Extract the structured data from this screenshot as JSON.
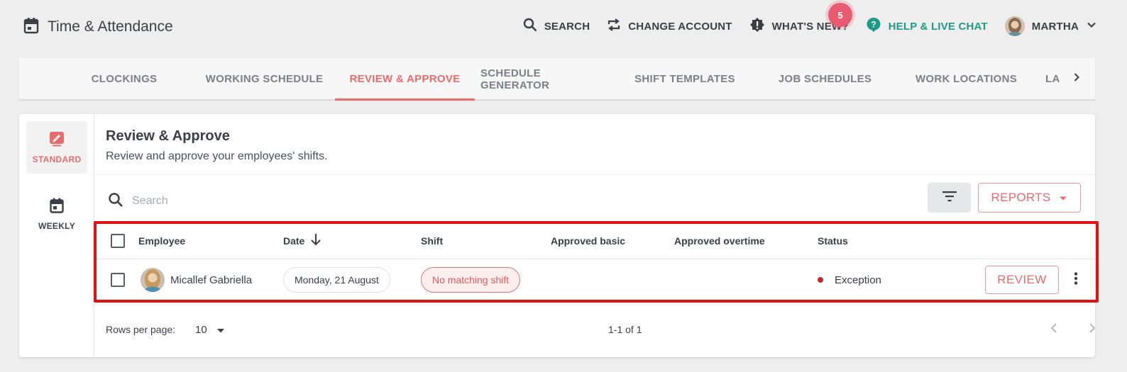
{
  "app": {
    "title": "Time & Attendance"
  },
  "top_actions": {
    "search": "SEARCH",
    "change_account": "CHANGE ACCOUNT",
    "whats_new": "WHAT'S NEW?",
    "whats_new_badge": "5",
    "help": "HELP & LIVE CHAT",
    "user": "MARTHA"
  },
  "tabs": [
    {
      "label": "CLOCKINGS",
      "active": false
    },
    {
      "label": "WORKING SCHEDULE",
      "active": false
    },
    {
      "label": "REVIEW & APPROVE",
      "active": true
    },
    {
      "label": "SCHEDULE GENERATOR",
      "active": false
    },
    {
      "label": "SHIFT TEMPLATES",
      "active": false
    },
    {
      "label": "JOB SCHEDULES",
      "active": false
    },
    {
      "label": "WORK LOCATIONS",
      "active": false
    },
    {
      "label": "LA",
      "active": false
    }
  ],
  "sidenav": {
    "standard": "STANDARD",
    "weekly": "WEEKLY"
  },
  "page": {
    "title": "Review & Approve",
    "subtitle": "Review and approve your employees' shifts."
  },
  "search": {
    "placeholder": "Search"
  },
  "reports_label": "REPORTS",
  "table": {
    "columns": {
      "employee": "Employee",
      "date": "Date",
      "shift": "Shift",
      "approved_basic": "Approved basic",
      "approved_overtime": "Approved overtime",
      "status": "Status"
    },
    "rows": [
      {
        "employee": "Micallef Gabriella",
        "date": "Monday, 21 August",
        "shift": "No matching shift",
        "approved_basic": "",
        "approved_overtime": "",
        "status": "Exception",
        "action": "REVIEW"
      }
    ]
  },
  "footer": {
    "rows_per_page_label": "Rows per page:",
    "rows_per_page_value": "10",
    "range": "1-1 of 1"
  },
  "colors": {
    "accent": "#ea6b6b",
    "help": "#1e9a86",
    "status_exception": "#c62828",
    "highlight": "#e31212"
  }
}
